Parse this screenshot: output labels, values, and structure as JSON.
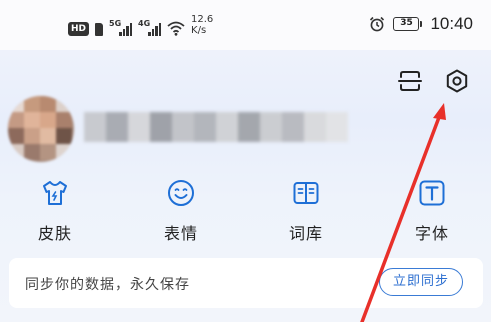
{
  "status_bar": {
    "hd_label": "HD",
    "signal_1_label": "5G",
    "signal_2_label": "4G",
    "speed_value": "12.6",
    "speed_unit": "K/s",
    "battery_level": "35",
    "time": "10:40"
  },
  "header": {
    "icons": [
      "scan-icon",
      "settings-icon"
    ]
  },
  "features": [
    {
      "label": "皮肤",
      "icon": "shirt-icon"
    },
    {
      "label": "表情",
      "icon": "smiley-icon"
    },
    {
      "label": "词库",
      "icon": "book-icon"
    },
    {
      "label": "字体",
      "icon": "font-icon"
    }
  ],
  "sync": {
    "text": "同步你的数据，永久保存",
    "button_label": "立即同步"
  },
  "colors": {
    "accent": "#2d6fd0",
    "annotation_arrow": "#e8302a"
  }
}
